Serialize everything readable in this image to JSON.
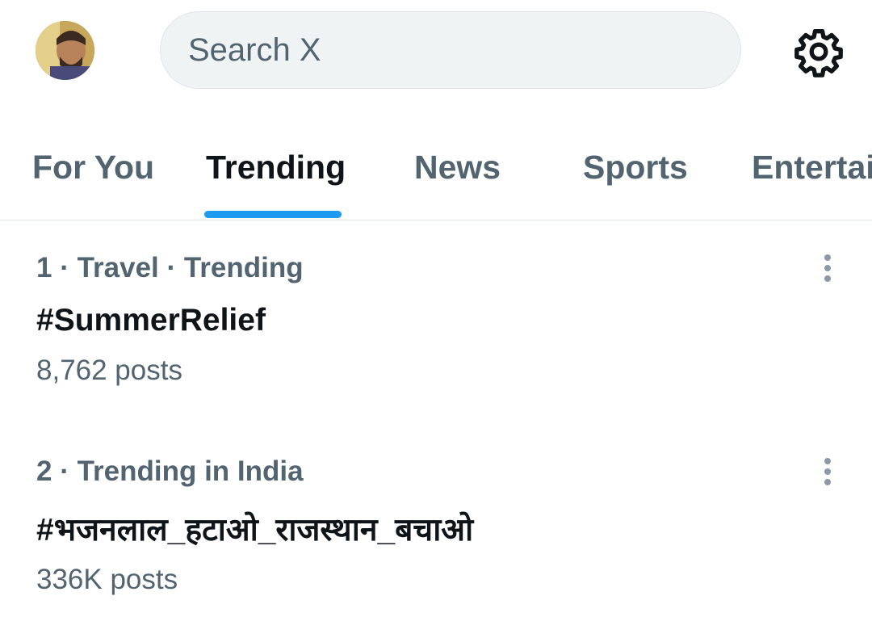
{
  "search": {
    "placeholder": "Search X"
  },
  "icons": {
    "avatar": "avatar",
    "settings": "gear-icon",
    "more": "more-vertical-icon"
  },
  "tabs": [
    {
      "label": "For You",
      "active": false
    },
    {
      "label": "Trending",
      "active": true
    },
    {
      "label": "News",
      "active": false
    },
    {
      "label": "Sports",
      "active": false
    },
    {
      "label": "Entertai",
      "active": false
    }
  ],
  "trends": [
    {
      "meta": "1 · Travel · Trending",
      "title": "#SummerRelief",
      "count": "8,762 posts"
    },
    {
      "meta": "2 · Trending in India",
      "title": "#भजनलाल_हटाओ_राजस्थान_बचाओ",
      "count": "336K posts"
    }
  ],
  "colors": {
    "accent": "#1d9bf0",
    "text_primary": "#0f1419",
    "text_secondary": "#536471",
    "search_bg": "#eff3f4",
    "divider": "#e1e6e8",
    "more_icon": "#8b98a5"
  }
}
